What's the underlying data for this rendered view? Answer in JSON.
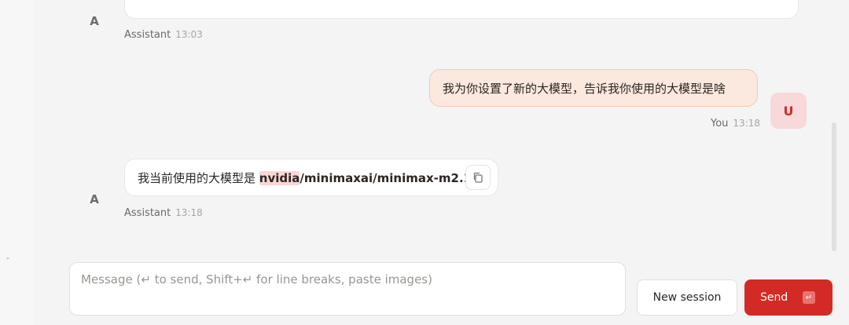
{
  "sidebar": {
    "collapsed_marker": "-"
  },
  "messages": [
    {
      "role": "assistant",
      "avatar": "A",
      "sender": "Assistant",
      "time": "13:03"
    },
    {
      "role": "user",
      "avatar": "U",
      "sender": "You",
      "time": "13:18",
      "text": "我为你设置了新的大模型，告诉我你使用的大模型是啥"
    },
    {
      "role": "assistant",
      "avatar": "A",
      "sender": "Assistant",
      "time": "13:18",
      "text_prefix": "我当前使用的大模型是 ",
      "model_highlight": "nvidia",
      "model_rest": "/minimaxai/minimax-m2.1",
      "text_suffix": "。"
    }
  ],
  "composer": {
    "placeholder": "Message (↵ to send, Shift+↵ for line breaks, paste images)",
    "new_session_label": "New session",
    "send_label": "Send",
    "send_shortcut_icon": "↵"
  },
  "colors": {
    "accent": "#d42a26",
    "user_bubble": "#fbe8de",
    "user_avatar_bg": "#f8d8d8"
  },
  "icons": {
    "copy": "copy-icon",
    "enter": "enter-key-icon"
  }
}
